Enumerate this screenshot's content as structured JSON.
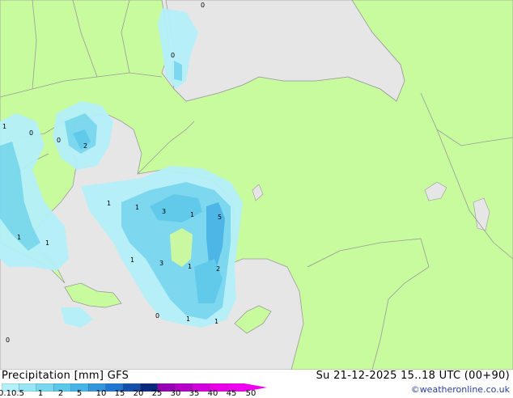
{
  "header": {
    "title": "Precipitation [mm] GFS",
    "datetime": "Su 21-12-2025 15..18 UTC (00+90)",
    "credit": "©weatheronline.co.uk"
  },
  "legend": {
    "labels": [
      "0.1",
      "0.5",
      "1",
      "2",
      "5",
      "10",
      "15",
      "20",
      "25",
      "30",
      "35",
      "40",
      "45",
      "50"
    ],
    "colors": [
      "#b4f0fa",
      "#96e6f5",
      "#78d7f0",
      "#5ac8eb",
      "#46b4e6",
      "#3296dc",
      "#1e78d2",
      "#1450aa",
      "#0a287d",
      "#9600b4",
      "#b400c8",
      "#d200dc",
      "#e600e6",
      "#f000f0"
    ]
  },
  "map_labels": [
    {
      "text": "0"
    },
    {
      "text": "0"
    },
    {
      "text": "1"
    },
    {
      "text": "0"
    },
    {
      "text": "0"
    },
    {
      "text": "2"
    },
    {
      "text": "1"
    },
    {
      "text": "1"
    },
    {
      "text": "3"
    },
    {
      "text": "1"
    },
    {
      "text": "5"
    },
    {
      "text": "1"
    },
    {
      "text": "1"
    },
    {
      "text": "1"
    },
    {
      "text": "3"
    },
    {
      "text": "1"
    },
    {
      "text": "2"
    },
    {
      "text": "0"
    },
    {
      "text": "1"
    },
    {
      "text": "1"
    },
    {
      "text": "0"
    }
  ],
  "colors": {
    "land": "#c8fa9e",
    "sea": "#e6e6e6",
    "border": "#9b9b9b"
  }
}
